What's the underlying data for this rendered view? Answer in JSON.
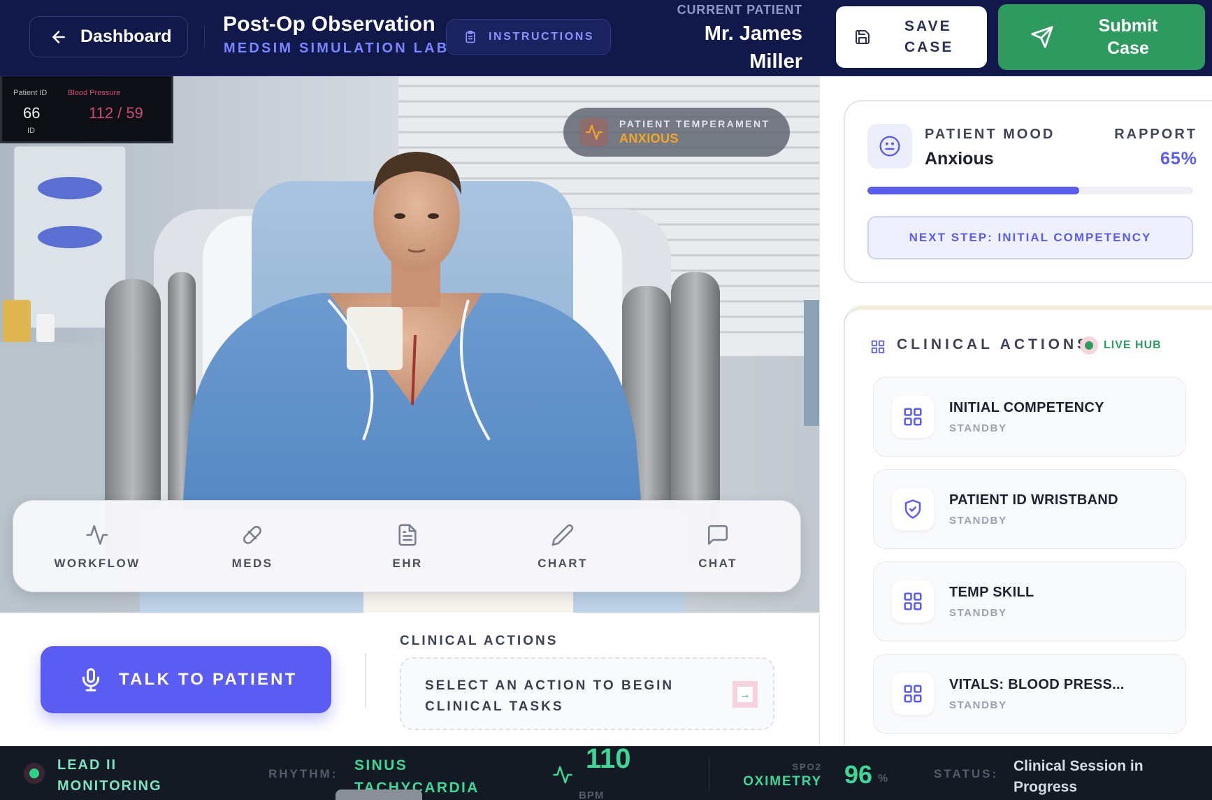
{
  "header": {
    "back_label": "Dashboard",
    "title": "Post-Op Observation",
    "subtitle": "MEDSIM SIMULATION LAB",
    "instructions_label": "INSTRUCTIONS",
    "current_patient_label": "CURRENT PATIENT",
    "patient_name": "Mr. James Miller",
    "save_label": "SAVE CASE",
    "submit_label": "Submit Case"
  },
  "scene": {
    "monitor": {
      "patient_id_label": "Patient ID",
      "patient_id_value": "66",
      "id_label": "ID",
      "bp_label": "Blood Pressure",
      "bp_value": "112 / 59"
    },
    "temperament_label": "PATIENT TEMPERAMENT",
    "temperament_value": "ANXIOUS",
    "toolbar": [
      {
        "label": "WORKFLOW",
        "icon": "activity-icon"
      },
      {
        "label": "MEDS",
        "icon": "pill-icon"
      },
      {
        "label": "EHR",
        "icon": "file-text-icon"
      },
      {
        "label": "CHART",
        "icon": "pencil-icon"
      },
      {
        "label": "CHAT",
        "icon": "message-square-icon"
      }
    ]
  },
  "actions_area": {
    "talk_label": "TALK TO PATIENT",
    "clinical_actions_label": "CLINICAL ACTIONS",
    "select_prompt": "SELECT AN ACTION TO BEGIN CLINICAL TASKS"
  },
  "mood": {
    "label": "PATIENT MOOD",
    "value": "Anxious",
    "rapport_label": "RAPPORT",
    "rapport_value": "65%",
    "rapport_fraction": 0.65,
    "next_step_label": "NEXT STEP: INITIAL COMPETENCY"
  },
  "clinical_actions": {
    "title": "CLINICAL ACTIONS",
    "live_label": "LIVE HUB",
    "items": [
      {
        "name": "INITIAL COMPETENCY",
        "status": "STANDBY",
        "icon": "grid-icon"
      },
      {
        "name": "PATIENT ID WRISTBAND",
        "status": "STANDBY",
        "icon": "shield-check-icon"
      },
      {
        "name": "TEMP SKILL",
        "status": "STANDBY",
        "icon": "grid-icon"
      },
      {
        "name": "VITALS: BLOOD PRESS...",
        "status": "STANDBY",
        "icon": "grid-icon"
      }
    ]
  },
  "status_bar": {
    "lead_label": "LEAD II MONITORING",
    "rhythm_label": "RHYTHM:",
    "rhythm_value": "SINUS TACHYCARDIA",
    "bpm_value": "110",
    "bpm_unit": "BPM",
    "spo2_label": "SPO2",
    "oximetry_label": "OXIMETRY",
    "spo2_value": "96",
    "spo2_unit": "%",
    "status_label": "STATUS:",
    "status_value": "Clinical Session in Progress"
  },
  "colors": {
    "header_bg": "#11184a",
    "accent": "#5b5cf2",
    "success": "#2e9a5f",
    "warning": "#f5a623",
    "vitals_green": "#3ed896"
  }
}
